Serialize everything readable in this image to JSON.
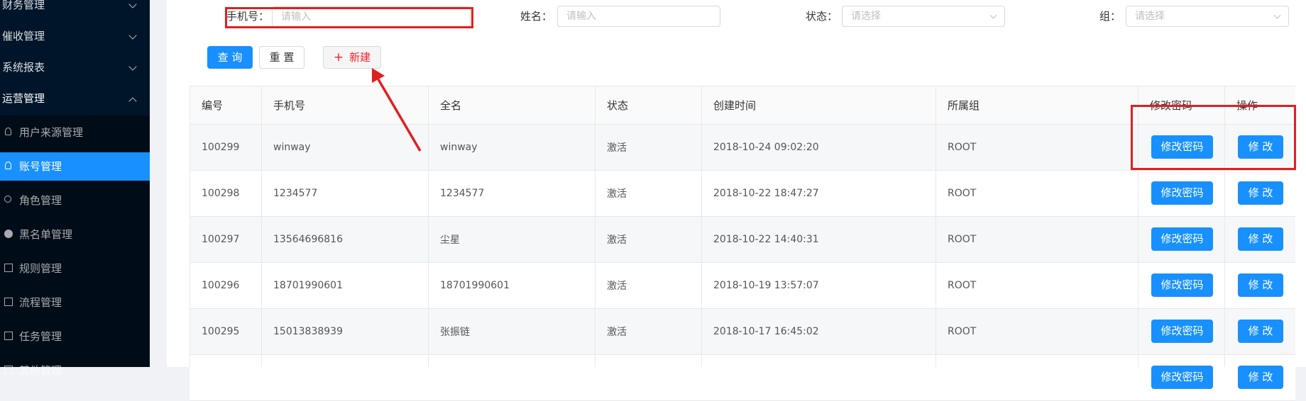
{
  "sidebar": {
    "groups": [
      {
        "label": "财务管理"
      },
      {
        "label": "催收管理"
      },
      {
        "label": "系统报表"
      },
      {
        "label": "运营管理"
      }
    ],
    "items": [
      {
        "label": "用户来源管理",
        "icon": "user-icon"
      },
      {
        "label": "账号管理",
        "icon": "user-icon"
      },
      {
        "label": "角色管理",
        "icon": "role-icon"
      },
      {
        "label": "黑名单管理",
        "icon": "blacklist-icon"
      },
      {
        "label": "规则管理",
        "icon": "list-icon"
      },
      {
        "label": "流程管理",
        "icon": "list-icon"
      },
      {
        "label": "任务管理",
        "icon": "list-icon"
      },
      {
        "label": "其他管理",
        "icon": "list-icon"
      }
    ]
  },
  "filters": {
    "phone_label": "手机号：",
    "phone_placeholder": "请输入",
    "name_label": "姓名：",
    "name_placeholder": "请输入",
    "status_label": "状态：",
    "status_placeholder": "请选择",
    "group_label": "组：",
    "group_placeholder": "请选择"
  },
  "actions": {
    "query": "查 询",
    "reset": "重 置",
    "new_icon": "+",
    "new": "新建"
  },
  "table": {
    "headers": [
      "编号",
      "手机号",
      "全名",
      "状态",
      "创建时间",
      "所属组",
      "修改密码",
      "操作"
    ],
    "rows": [
      {
        "id": "100299",
        "phone": "winway",
        "name": "winway",
        "status": "激活",
        "created": "2018-10-24 09:02:20",
        "group": "ROOT",
        "pwd_btn": "修改密码",
        "edit_btn": "修 改"
      },
      {
        "id": "100298",
        "phone": "1234577",
        "name": "1234577",
        "status": "激活",
        "created": "2018-10-22 18:47:27",
        "group": "ROOT",
        "pwd_btn": "修改密码",
        "edit_btn": "修 改"
      },
      {
        "id": "100297",
        "phone": "13564696816",
        "name": "尘星",
        "status": "激活",
        "created": "2018-10-22 14:40:31",
        "group": "ROOT",
        "pwd_btn": "修改密码",
        "edit_btn": "修 改"
      },
      {
        "id": "100296",
        "phone": "18701990601",
        "name": "18701990601",
        "status": "激活",
        "created": "2018-10-19 13:57:07",
        "group": "ROOT",
        "pwd_btn": "修改密码",
        "edit_btn": "修 改"
      },
      {
        "id": "100295",
        "phone": "15013838939",
        "name": "张振链",
        "status": "激活",
        "created": "2018-10-17 16:45:02",
        "group": "ROOT",
        "pwd_btn": "修改密码",
        "edit_btn": "修 改"
      },
      {
        "id": "",
        "phone": "",
        "name": "",
        "status": "",
        "created": "",
        "group": "",
        "pwd_btn": "修改密码",
        "edit_btn": "修 改"
      }
    ]
  },
  "colors": {
    "primary": "#1890ff",
    "sidebar_bg": "#001529",
    "annotation": "#e02020"
  }
}
